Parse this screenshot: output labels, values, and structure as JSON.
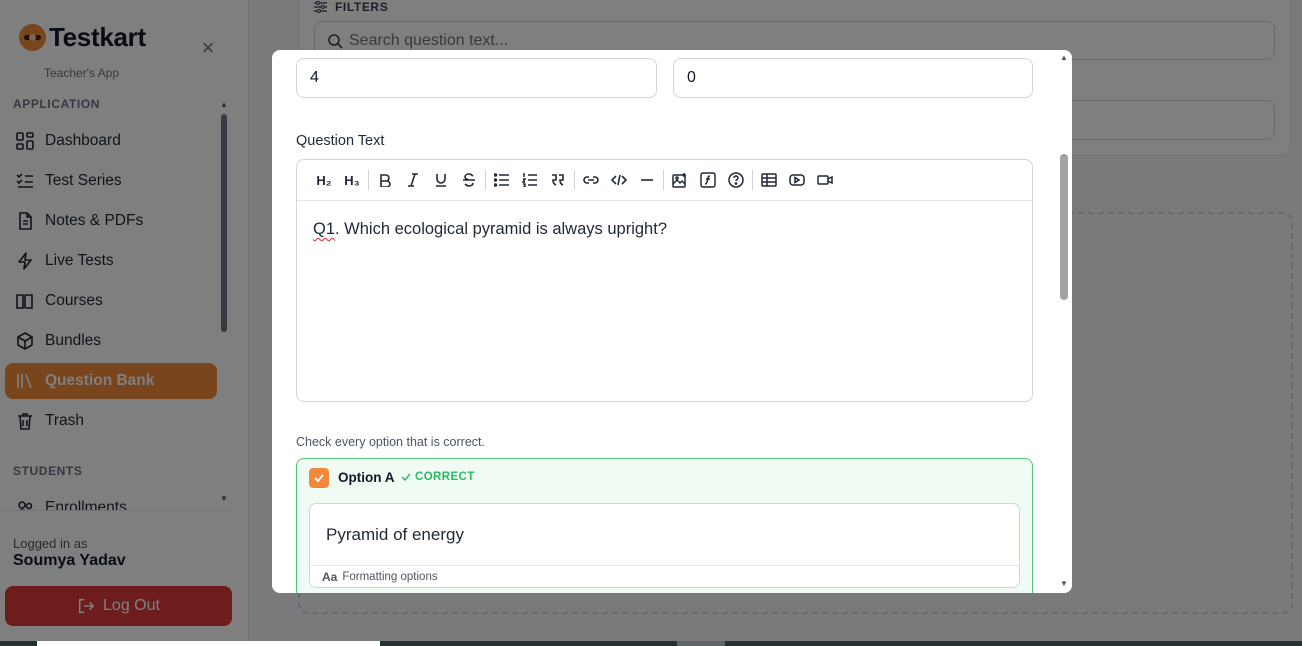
{
  "sidebar": {
    "brand": "Testkart",
    "subtitle": "Teacher's App",
    "sections": [
      {
        "label": "APPLICATION"
      },
      {
        "label": "STUDENTS"
      }
    ],
    "items": [
      {
        "label": "Dashboard",
        "icon": "dashboard-icon"
      },
      {
        "label": "Test Series",
        "icon": "checklist-icon"
      },
      {
        "label": "Notes & PDFs",
        "icon": "document-icon"
      },
      {
        "label": "Live Tests",
        "icon": "lightning-icon"
      },
      {
        "label": "Courses",
        "icon": "book-icon"
      },
      {
        "label": "Bundles",
        "icon": "package-icon"
      },
      {
        "label": "Question Bank",
        "icon": "library-icon",
        "active": true
      },
      {
        "label": "Trash",
        "icon": "trash-icon"
      },
      {
        "label": "Enrollments",
        "icon": "users-icon"
      }
    ],
    "logged_in_label": "Logged in as",
    "user_name": "Soumya Yadav",
    "logout_label": "Log Out"
  },
  "background": {
    "filters_label": "FILTERS",
    "search_placeholder": "Search question text..."
  },
  "modal": {
    "marks_value": "4",
    "negative_value": "0",
    "question_label": "Question Text",
    "question_prefix": "Q1",
    "question_rest": ". Which ecological pyramid is always upright?",
    "toolbar": {
      "h2": "H₂",
      "h3": "H₃"
    },
    "hint": "Check every option that is correct.",
    "option": {
      "title": "Option A",
      "status": "CORRECT",
      "text": "Pyramid of energy",
      "format_icon": "Aa",
      "format_label": "Formatting options"
    }
  },
  "colors": {
    "accent": "#f08a3a",
    "danger": "#dc3a3a",
    "success": "#2db866"
  }
}
